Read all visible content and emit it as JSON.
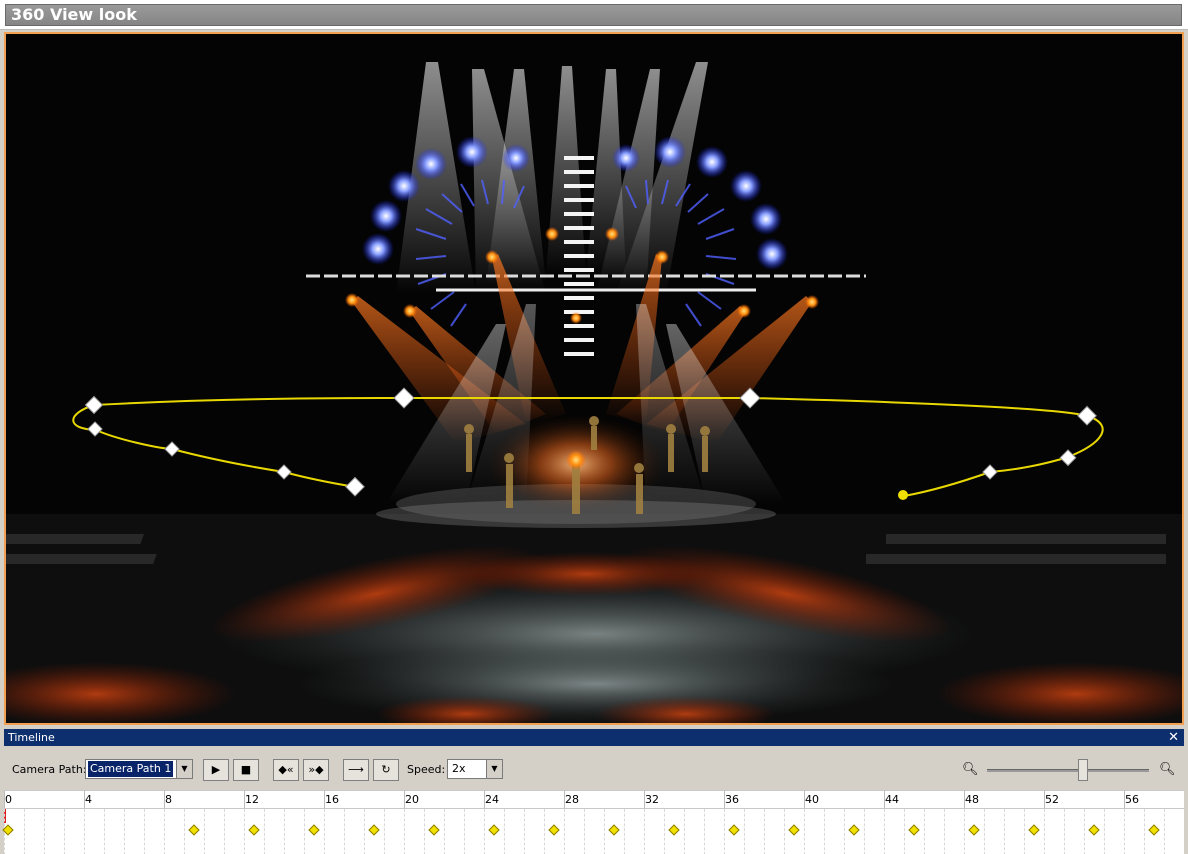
{
  "viewport": {
    "title": "360 View look"
  },
  "timeline": {
    "header": "Timeline",
    "close_glyph": "✕",
    "camera_path_label": "Camera Path:",
    "camera_path_value": "Camera Path 1",
    "speed_label": "Speed:",
    "speed_value": "2x",
    "buttons": {
      "play": "play-icon",
      "stop": "stop-icon",
      "prev_key": "prev-keyframe-icon",
      "next_key": "next-keyframe-icon",
      "go_end": "arrow-right-icon",
      "loop": "loop-icon"
    },
    "zoom_level": 0.5,
    "ruler_ticks": [
      "0",
      "4",
      "8",
      "12",
      "16",
      "20",
      "24",
      "28",
      "32",
      "36",
      "40",
      "44",
      "48",
      "52",
      "56"
    ],
    "keyframes": [
      0,
      9.5,
      12.5,
      15.5,
      18.5,
      21.5,
      24.5,
      27.5,
      30.5,
      33.5,
      36.5,
      39.5,
      42.5,
      45.5,
      48.5,
      51.5,
      54.5,
      57.5
    ]
  },
  "colors": {
    "accent_border": "#f0a050",
    "timeline_header": "#0d2f6e",
    "keyframe": "#f0e000",
    "camera_path": "#e8d800"
  }
}
